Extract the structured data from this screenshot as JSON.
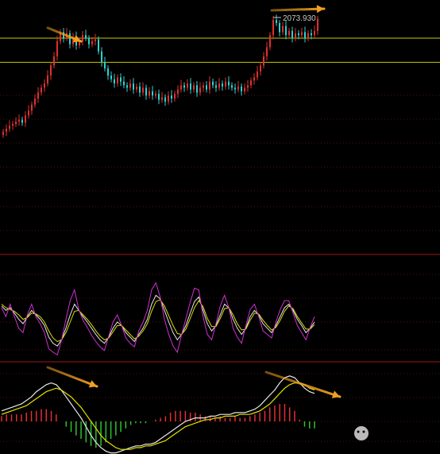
{
  "chart_data": [
    {
      "type": "candlestick",
      "panel": "price",
      "annotation": "2073.930",
      "colors": {
        "up": "#e03030",
        "down": "#30d0d0",
        "hline": "#c8c800",
        "arrow": "#f0a020"
      },
      "horizontal_levels": [
        2040,
        2000
      ],
      "ylim": [
        1840,
        2090
      ],
      "closes": [
        1885,
        1890,
        1895,
        1898,
        1902,
        1905,
        1900,
        1912,
        1920,
        1930,
        1940,
        1950,
        1958,
        1965,
        1978,
        1995,
        2010,
        2035,
        2050,
        2040,
        2048,
        2030,
        2042,
        2028,
        2035,
        2045,
        2040,
        2030,
        2035,
        2038,
        2018,
        2000,
        1990,
        1978,
        1972,
        1965,
        1975,
        1968,
        1962,
        1958,
        1965,
        1955,
        1960,
        1950,
        1958,
        1945,
        1952,
        1945,
        1948,
        1938,
        1942,
        1935,
        1945,
        1940,
        1948,
        1955,
        1962,
        1958,
        1965,
        1955,
        1962,
        1950,
        1958,
        1962,
        1955,
        1968,
        1962,
        1958,
        1965,
        1960,
        1968,
        1962,
        1958,
        1955,
        1960,
        1952,
        1958,
        1962,
        1970,
        1975,
        1985,
        1995,
        2010,
        2025,
        2045,
        2070,
        2065,
        2050,
        2060,
        2045,
        2052,
        2040,
        2048,
        2045,
        2050,
        2040,
        2048,
        2045,
        2052,
        2072
      ],
      "opens": [
        1880,
        1885,
        1890,
        1895,
        1898,
        1902,
        1905,
        1900,
        1912,
        1920,
        1930,
        1940,
        1950,
        1958,
        1965,
        1978,
        1995,
        2010,
        2035,
        2050,
        2040,
        2048,
        2030,
        2042,
        2028,
        2035,
        2045,
        2040,
        2030,
        2035,
        2038,
        2018,
        2000,
        1990,
        1978,
        1972,
        1965,
        1975,
        1968,
        1962,
        1958,
        1965,
        1955,
        1960,
        1950,
        1958,
        1945,
        1952,
        1945,
        1948,
        1938,
        1942,
        1935,
        1945,
        1940,
        1948,
        1955,
        1962,
        1958,
        1965,
        1955,
        1962,
        1950,
        1958,
        1962,
        1955,
        1968,
        1962,
        1958,
        1965,
        1960,
        1968,
        1962,
        1958,
        1955,
        1960,
        1952,
        1958,
        1962,
        1970,
        1975,
        1985,
        1995,
        2010,
        2025,
        2045,
        2070,
        2065,
        2050,
        2060,
        2045,
        2052,
        2040,
        2048,
        2045,
        2050,
        2040,
        2048,
        2045,
        2052
      ]
    },
    {
      "type": "line",
      "panel": "kdj",
      "ylim": [
        0,
        100
      ],
      "series": [
        {
          "color": "#e8e8e8",
          "values": [
            60,
            55,
            58,
            52,
            45,
            40,
            48,
            55,
            50,
            45,
            38,
            25,
            18,
            15,
            22,
            35,
            50,
            62,
            55,
            48,
            42,
            35,
            28,
            22,
            18,
            25,
            35,
            42,
            38,
            30,
            25,
            20,
            28,
            35,
            45,
            62,
            72,
            68,
            55,
            42,
            30,
            22,
            28,
            38,
            52,
            65,
            70,
            55,
            40,
            32,
            38,
            50,
            62,
            58,
            45,
            35,
            28,
            35,
            48,
            55,
            50,
            40,
            35,
            30,
            38,
            48,
            58,
            62,
            55,
            45,
            38,
            30,
            35,
            42
          ]
        },
        {
          "color": "#e0e000",
          "values": [
            62,
            58,
            56,
            54,
            50,
            45,
            47,
            52,
            51,
            48,
            42,
            32,
            24,
            20,
            22,
            30,
            42,
            54,
            55,
            50,
            45,
            39,
            32,
            26,
            22,
            24,
            31,
            38,
            38,
            33,
            28,
            23,
            26,
            32,
            40,
            54,
            65,
            67,
            60,
            49,
            38,
            29,
            28,
            34,
            46,
            58,
            66,
            59,
            46,
            37,
            37,
            46,
            57,
            58,
            50,
            40,
            33,
            34,
            44,
            52,
            51,
            44,
            38,
            33,
            36,
            44,
            54,
            60,
            57,
            48,
            41,
            34,
            34,
            39
          ]
        },
        {
          "color": "#d030d0",
          "values": [
            58,
            48,
            62,
            48,
            35,
            30,
            50,
            62,
            48,
            40,
            30,
            12,
            8,
            5,
            22,
            45,
            66,
            78,
            56,
            44,
            36,
            27,
            20,
            14,
            10,
            26,
            42,
            50,
            38,
            24,
            18,
            14,
            32,
            42,
            55,
            78,
            86,
            70,
            45,
            28,
            15,
            8,
            28,
            46,
            64,
            80,
            78,
            48,
            28,
            22,
            40,
            60,
            72,
            58,
            35,
            25,
            18,
            38,
            56,
            62,
            48,
            32,
            28,
            24,
            42,
            56,
            66,
            66,
            52,
            38,
            30,
            22,
            36,
            48
          ]
        }
      ]
    },
    {
      "type": "bar+line",
      "panel": "macd",
      "histogram_colors": {
        "pos": "#e03030",
        "neg": "#30c030"
      },
      "lines": [
        {
          "color": "#e8e8e8",
          "values": [
            6,
            7,
            8,
            9,
            10,
            12,
            14,
            17,
            19,
            21,
            22,
            21,
            18,
            14,
            10,
            6,
            2,
            -3,
            -8,
            -12,
            -15,
            -17,
            -18,
            -18,
            -17,
            -16,
            -15,
            -14,
            -14,
            -13,
            -13,
            -12,
            -10,
            -8,
            -6,
            -4,
            -2,
            0,
            1,
            2,
            2,
            2,
            3,
            3,
            4,
            4,
            4,
            5,
            5,
            5,
            6,
            7,
            9,
            12,
            15,
            18,
            22,
            25,
            26,
            25,
            22,
            19,
            17,
            16
          ]
        },
        {
          "color": "#e0e000",
          "values": [
            4,
            5,
            6,
            7,
            8,
            9,
            11,
            13,
            15,
            17,
            18,
            19,
            18,
            16,
            14,
            11,
            8,
            4,
            0,
            -4,
            -8,
            -11,
            -13,
            -15,
            -16,
            -16,
            -16,
            -15,
            -15,
            -14,
            -14,
            -13,
            -12,
            -11,
            -9,
            -7,
            -5,
            -3,
            -2,
            -1,
            0,
            1,
            1,
            2,
            2,
            3,
            3,
            3,
            4,
            4,
            4,
            5,
            6,
            8,
            10,
            13,
            16,
            19,
            21,
            22,
            22,
            21,
            19,
            18
          ]
        }
      ],
      "histogram": [
        3,
        4,
        4,
        4,
        4,
        5,
        6,
        6,
        7,
        7,
        6,
        4,
        0,
        -3,
        -6,
        -8,
        -10,
        -12,
        -14,
        -15,
        -14,
        -12,
        -10,
        -8,
        -6,
        -4,
        -2,
        -1,
        -1,
        -1,
        0,
        1,
        2,
        3,
        5,
        6,
        6,
        6,
        5,
        5,
        4,
        3,
        3,
        2,
        3,
        2,
        2,
        3,
        2,
        2,
        3,
        4,
        5,
        6,
        8,
        9,
        10,
        10,
        8,
        6,
        1,
        -3,
        -4,
        -4
      ]
    }
  ]
}
